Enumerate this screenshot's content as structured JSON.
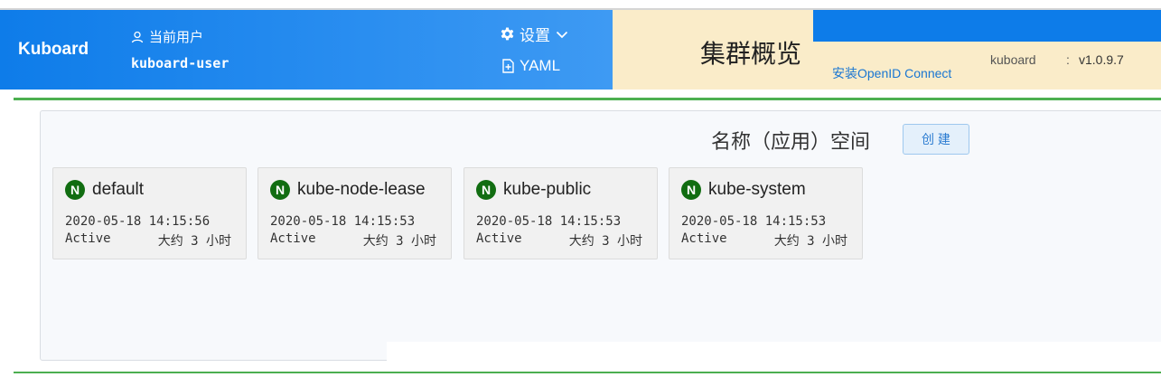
{
  "app": {
    "brand": "Kuboard"
  },
  "user": {
    "label": "当前用户",
    "name": "kuboard-user"
  },
  "toolbar": {
    "settings_label": "设置",
    "yaml_label": "YAML"
  },
  "page": {
    "title": "集群概览"
  },
  "info": {
    "openid_link": "安装OpenID Connect",
    "kuboard_label": "kuboard",
    "kuboard_version": "v1.0.9.7",
    "colon": ":"
  },
  "namespaces": {
    "title": "名称（应用）空间",
    "create_label": "创 建",
    "badge": "N",
    "items": [
      {
        "name": "default",
        "created": "2020-05-18 14:15:56",
        "status": "Active",
        "age": "大约 3 小时"
      },
      {
        "name": "kube-node-lease",
        "created": "2020-05-18 14:15:53",
        "status": "Active",
        "age": "大约 3 小时"
      },
      {
        "name": "kube-public",
        "created": "2020-05-18 14:15:53",
        "status": "Active",
        "age": "大约 3 小时"
      },
      {
        "name": "kube-system",
        "created": "2020-05-18 14:15:53",
        "status": "Active",
        "age": "大约 3 小时"
      }
    ]
  },
  "colors": {
    "header_blue": "#0e7ce9",
    "title_bg": "#faecc9",
    "accent_green": "#4caf50",
    "badge_green": "#116d11",
    "link_blue": "#1976d2"
  }
}
